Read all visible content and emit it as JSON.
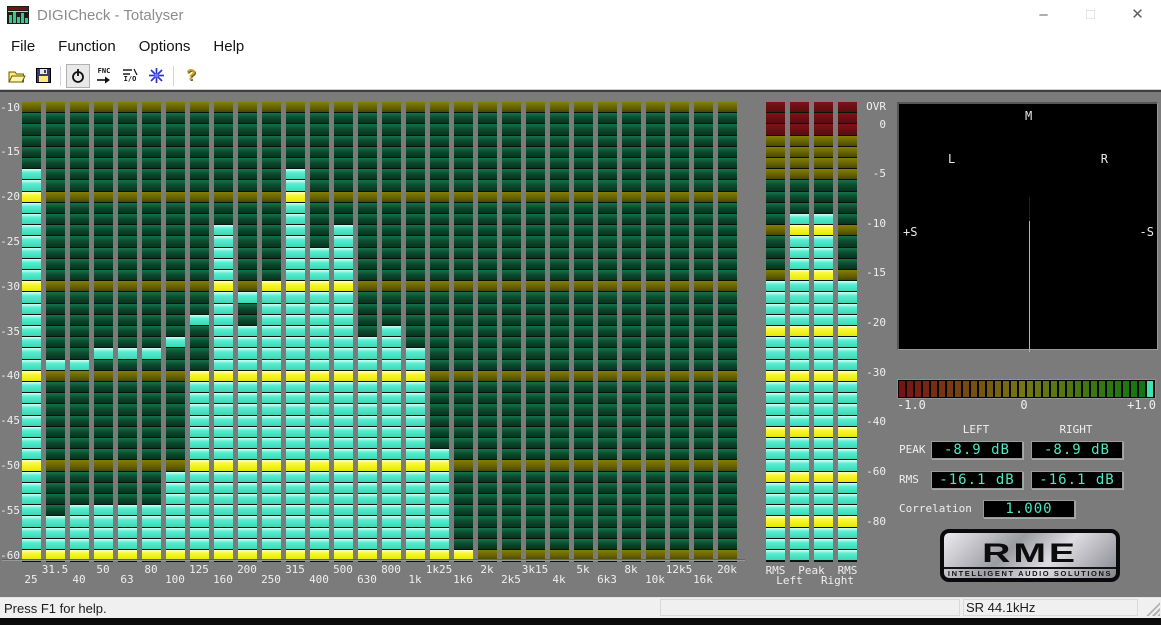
{
  "window": {
    "title": "DIGICheck - Totalyser",
    "controls": {
      "minimize": "–",
      "maximize": "□",
      "close": "✕"
    }
  },
  "menu": {
    "items": [
      "File",
      "Function",
      "Options",
      "Help"
    ]
  },
  "toolbar": {
    "fnc_label": "FNC",
    "io_label": "I/O",
    "help_glyph": "?"
  },
  "chart_data": [
    {
      "type": "bar",
      "title": "30-band third-octave spectrum analyser",
      "ylim": [
        -60,
        -10
      ],
      "yticks": [
        "-10",
        "-15",
        "-20",
        "-25",
        "-30",
        "-35",
        "-40",
        "-45",
        "-50",
        "-55",
        "-60"
      ],
      "categories": [
        "25",
        "31.5",
        "40",
        "50",
        "63",
        "80",
        "100",
        "125",
        "160",
        "200",
        "250",
        "315",
        "400",
        "500",
        "630",
        "800",
        "1k",
        "1k25",
        "1k6",
        "2k",
        "2k5",
        "3k15",
        "4k",
        "5k",
        "6k3",
        "8k",
        "10k",
        "12k5",
        "16k",
        "20k"
      ],
      "series": [
        {
          "name": "level_db",
          "values": [
            -17.5,
            -56.25,
            -55,
            -55,
            -55,
            -55,
            -51.25,
            -40,
            -23.75,
            -35,
            -30,
            -17.5,
            -26.25,
            -23.75,
            -36.25,
            -35,
            -37.5,
            -48.75,
            -60,
            null,
            null,
            null,
            null,
            null,
            null,
            null,
            null,
            null,
            null,
            null
          ]
        },
        {
          "name": "peak_hold_db",
          "values": [
            null,
            -38.75,
            -38.75,
            -37.5,
            -37.5,
            -37.5,
            -36.25,
            -33.75,
            null,
            -31.25,
            null,
            null,
            null,
            null,
            null,
            null,
            null,
            null,
            null,
            null,
            null,
            null,
            null,
            null,
            null,
            null,
            null,
            null,
            null,
            null
          ]
        }
      ]
    },
    {
      "type": "level-meters",
      "scale_labels": [
        "OVR",
        "0",
        "-5",
        "-10",
        "-15",
        "-20",
        "-30",
        "-40",
        "-60",
        "-80"
      ],
      "columns": [
        {
          "name": "RMS Left",
          "db": -16.1
        },
        {
          "name": "Peak Left",
          "db": -8.9
        },
        {
          "name": "Peak Right",
          "db": -8.9
        },
        {
          "name": "RMS Right",
          "db": -16.1
        }
      ],
      "bottom_labels_row1": [
        "RMS",
        "Peak",
        "RMS"
      ],
      "bottom_labels_row2": [
        "Left",
        "Right"
      ]
    },
    {
      "type": "goniometer",
      "labels": {
        "top": "M",
        "left": "L",
        "right": "R",
        "plus_s": "+S",
        "minus_s": "-S"
      },
      "trace": "vertical center line (mono signal)"
    },
    {
      "type": "correlation-meter",
      "value": 1.0,
      "axis_labels": [
        "-1.0",
        "0",
        "+1.0"
      ]
    }
  ],
  "readouts": {
    "channel_headers": [
      "LEFT",
      "RIGHT"
    ],
    "rows": [
      {
        "label": "PEAK",
        "values": [
          "-8.9 dB",
          "-8.9 dB"
        ]
      },
      {
        "label": "RMS",
        "values": [
          "-16.1 dB",
          "-16.1 dB"
        ]
      }
    ],
    "correlation": {
      "label": "Correlation",
      "value": "1.000"
    }
  },
  "logo": {
    "brand": "RME",
    "tagline": "INTELLIGENT AUDIO SOLUTIONS"
  },
  "status": {
    "message": "Press F1 for help.",
    "sample_rate": "SR 44.1kHz"
  },
  "colors": {
    "segment_lit": "#4fe9c8",
    "segment_marker_lit": "#f0f000",
    "segment_unlit": "#0b4a2d",
    "segment_marker_unlit": "#6b6600",
    "segment_over_unlit": "#6b0d10",
    "goniometer_trace": "#79cf9f",
    "readout_text": "#4be8c4"
  }
}
